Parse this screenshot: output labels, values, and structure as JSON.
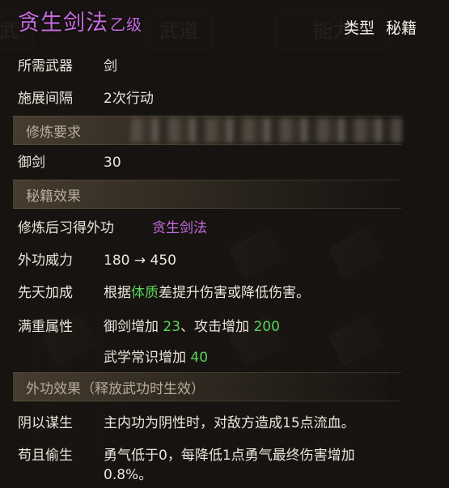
{
  "background": {
    "tabs": [
      "武",
      "武道",
      "能力"
    ]
  },
  "tooltip": {
    "title": "贪生剑法",
    "grade": "乙级",
    "type_label": "类型",
    "type_value": "秘籍",
    "rows": {
      "weapon_label": "所需武器",
      "weapon_value": "剑",
      "interval_label": "施展间隔",
      "interval_value": "2次行动",
      "req_section": "修炼要求",
      "sword_label": "御剑",
      "sword_value": "30",
      "effect_section": "秘籍效果",
      "learn_label": "修炼后习得外功",
      "learn_value": "贪生剑法",
      "power_label": "外功威力",
      "power_value": "180 → 450",
      "innate_label": "先天加成",
      "innate_pre": "根据",
      "innate_highlight": "体质",
      "innate_post": "差提升伤害或降低伤害。",
      "max_label": "满重属性",
      "max_line1_a": "御剑增加 ",
      "max_line1_a_val": "23",
      "max_line1_b": "、攻击增加 ",
      "max_line1_b_val": "200",
      "max_line2_a": "武学常识增加 ",
      "max_line2_a_val": "40",
      "external_section": "外功效果（释放武功时生效）",
      "yin_label": "阴以谋生",
      "yin_value": "主内功为阴性时，对敌方造成15点流血。",
      "gou_label": "苟且偷生",
      "gou_value_1": "勇气低于0，每降低1点勇气最终伤害增加",
      "gou_value_2": "0.8%。"
    }
  },
  "colors": {
    "title": "#c86be0",
    "highlight_green": "#59d35a",
    "text": "#ebe6dc"
  }
}
